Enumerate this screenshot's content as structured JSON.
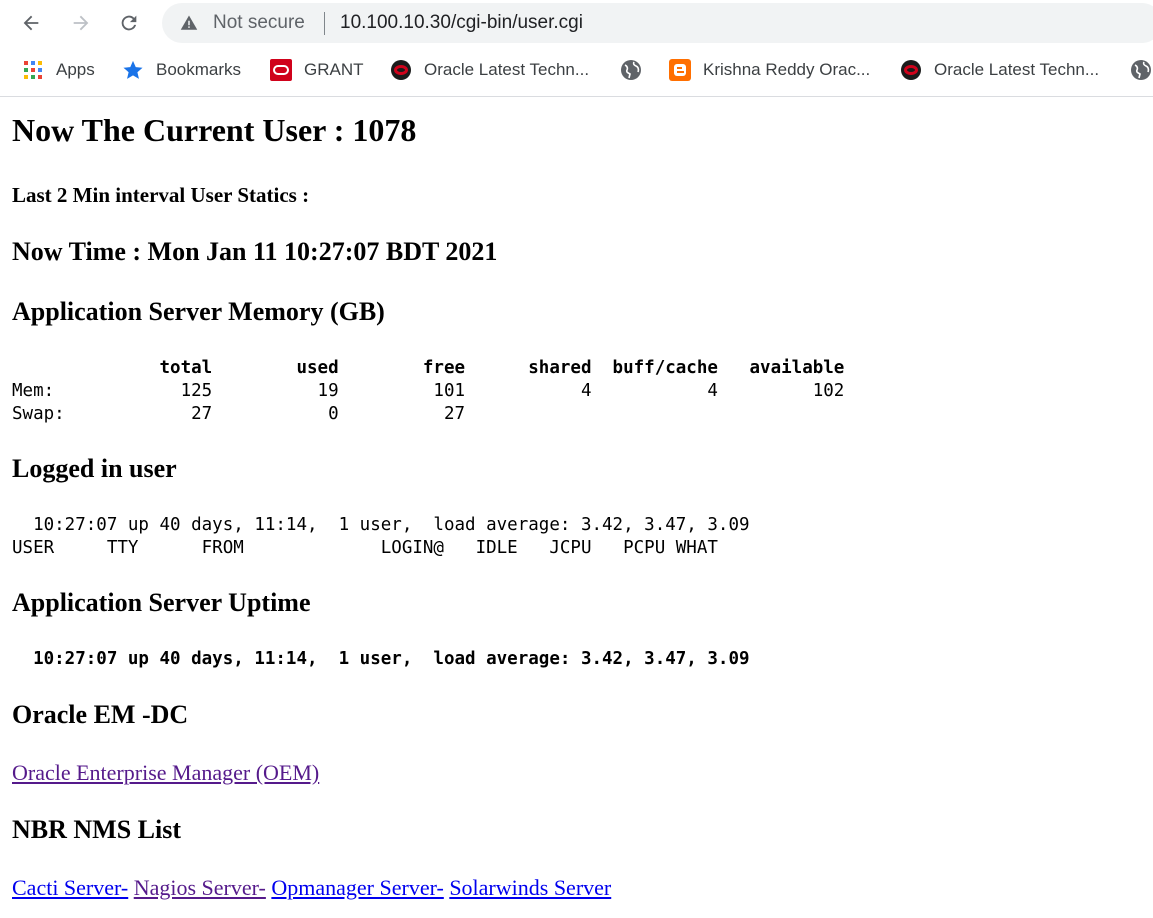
{
  "browser": {
    "security_label": "Not secure",
    "url": "10.100.10.30/cgi-bin/user.cgi",
    "bookmarks": [
      {
        "label": "Apps",
        "icon": "apps-grid-icon"
      },
      {
        "label": "Bookmarks",
        "icon": "star-icon"
      },
      {
        "label": "GRANT",
        "icon": "oracle-icon"
      },
      {
        "label": "Oracle Latest Techn...",
        "icon": "oracle-ace-icon"
      },
      {
        "label": "",
        "icon": "globe-icon"
      },
      {
        "label": "Krishna Reddy Orac...",
        "icon": "blogger-icon"
      },
      {
        "label": "Oracle Latest Techn...",
        "icon": "oracle-ace-icon"
      },
      {
        "label": "",
        "icon": "globe-icon"
      }
    ]
  },
  "page": {
    "title": "Now The Current User : 1078",
    "last_interval": "Last 2 Min interval User Statics :",
    "now_time": "Now Time : Mon Jan 11 10:27:07 BDT 2021",
    "memory_heading": "Application Server Memory (GB)",
    "memory_table": {
      "header": "              total        used        free      shared  buff/cache   available",
      "mem": "Mem:            125          19         101           4           4         102",
      "swap": "Swap:            27           0          27"
    },
    "logged_heading": "Logged in user",
    "logged_output": {
      "line1": "  10:27:07 up 40 days, 11:14,  1 user,  load average: 3.42, 3.47, 3.09",
      "line2": "USER     TTY      FROM             LOGIN@   IDLE   JCPU   PCPU WHAT"
    },
    "uptime_heading": "Application Server Uptime",
    "uptime_output": "  10:27:07 up 40 days, 11:14,  1 user,  load average: 3.42, 3.47, 3.09",
    "oem_heading": "Oracle EM -DC",
    "oem_link": "Oracle Enterprise Manager (OEM)",
    "nms_heading": "NBR NMS List",
    "nms_links": [
      "Cacti Server-",
      "Nagios Server-",
      "Opmanager Server-",
      "Solarwinds Server"
    ]
  },
  "colors": {
    "link_visited": "#551a8b",
    "link_unvisited": "#0000ee",
    "omnibox_bg": "#f1f3f4"
  }
}
